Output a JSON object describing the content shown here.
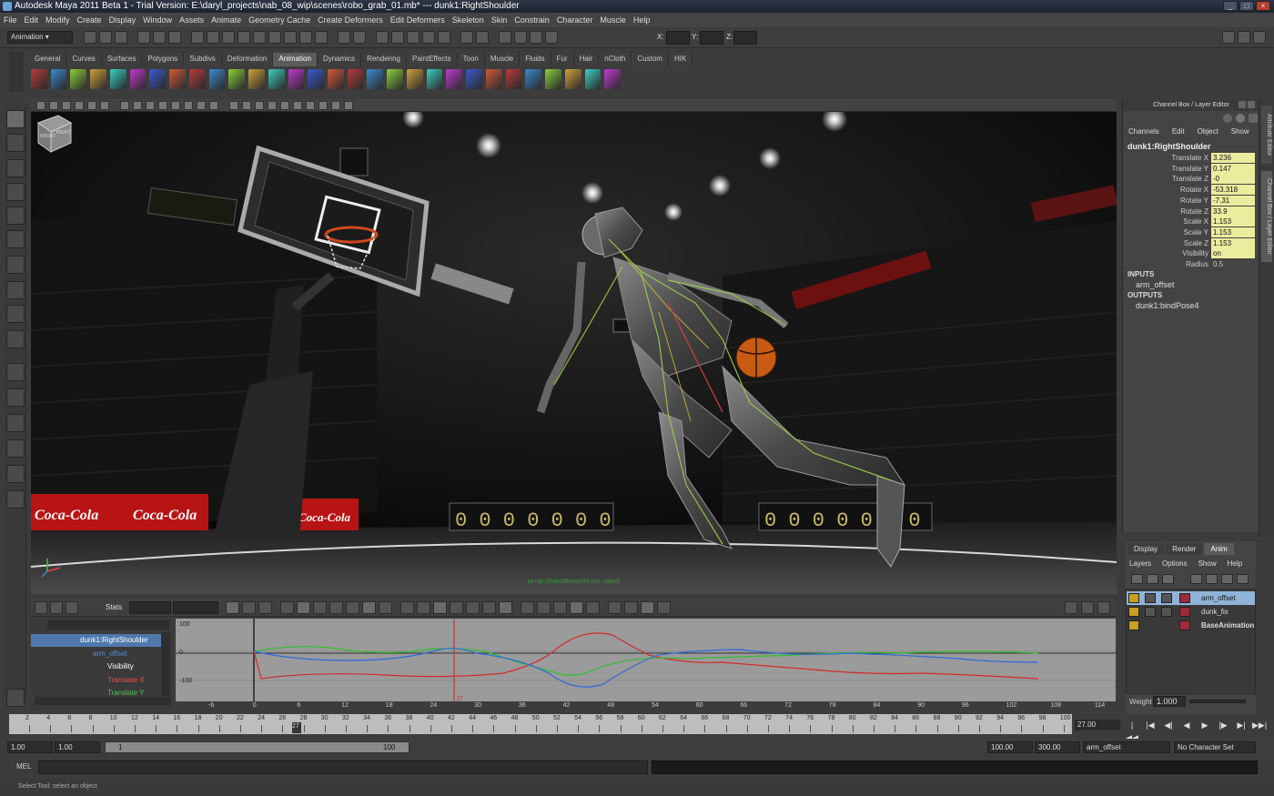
{
  "window": {
    "title": "Autodesk Maya 2011 Beta 1 - Trial Version: E:\\daryl_projects\\nab_08_wip\\scenes\\robo_grab_01.mb*  ---  dunk1:RightShoulder"
  },
  "menubar": [
    "File",
    "Edit",
    "Modify",
    "Create",
    "Display",
    "Window",
    "Assets",
    "Animate",
    "Geometry Cache",
    "Create Deformers",
    "Edit Deformers",
    "Skeleton",
    "Skin",
    "Constrain",
    "Character",
    "Muscle",
    "Help"
  ],
  "statusline": {
    "mode": "Animation",
    "x_label": "X:",
    "y_label": "Y:",
    "z_label": "Z:"
  },
  "shelf": {
    "tabs": [
      "General",
      "Curves",
      "Surfaces",
      "Polygons",
      "Subdivs",
      "Deformation",
      "Animation",
      "Dynamics",
      "Rendering",
      "PaintEffects",
      "Toon",
      "Muscle",
      "Fluids",
      "Fur",
      "Hair",
      "nCloth",
      "Custom",
      "HIK"
    ],
    "active_tab": "Animation"
  },
  "viewport": {
    "scene_caption": "persp (RobotBlueprint.mb: robot)",
    "viewcube_labels": [
      "FRONT",
      "RIGHT"
    ],
    "sign_text": "Coca-Cola"
  },
  "channel_box": {
    "title": "Channel Box / Layer Editor",
    "menu": [
      "Channels",
      "Edit",
      "Object",
      "Show"
    ],
    "node": "dunk1:RightShoulder",
    "attributes": [
      {
        "label": "Translate X",
        "value": "3.236",
        "keyed": true
      },
      {
        "label": "Translate Y",
        "value": "0.147",
        "keyed": true
      },
      {
        "label": "Translate Z",
        "value": "-0",
        "keyed": true
      },
      {
        "label": "Rotate X",
        "value": "-53.318",
        "keyed": true
      },
      {
        "label": "Rotate Y",
        "value": "-7.31",
        "keyed": true
      },
      {
        "label": "Rotate Z",
        "value": "33.9",
        "keyed": true
      },
      {
        "label": "Scale X",
        "value": "1.153",
        "keyed": true
      },
      {
        "label": "Scale Y",
        "value": "1.153",
        "keyed": true
      },
      {
        "label": "Scale Z",
        "value": "1.153",
        "keyed": true
      },
      {
        "label": "Visibility",
        "value": "on",
        "keyed": true
      },
      {
        "label": "Radius",
        "value": "0.5",
        "keyed": false
      }
    ],
    "inputs_label": "INPUTS",
    "inputs": [
      "arm_offset"
    ],
    "outputs_label": "OUTPUTS",
    "outputs": [
      "dunk1:bindPose4"
    ]
  },
  "side_tabs": [
    "Attribute Editor",
    "Channel Box / Layer Editor"
  ],
  "layer_editor": {
    "tabs": [
      "Display",
      "Render",
      "Anim"
    ],
    "active_tab": "Anim",
    "menu": [
      "Layers",
      "Options",
      "Show",
      "Help"
    ],
    "layers": [
      {
        "name": "arm_offset",
        "selected": true
      },
      {
        "name": "dunk_fix",
        "selected": false
      },
      {
        "name": "BaseAnimation",
        "selected": false,
        "bold": true
      }
    ],
    "weight_label": "Weight",
    "weight_value": "1.000"
  },
  "graph_editor": {
    "stats_label": "Stats",
    "outliner": [
      {
        "label": "dunk1:RightShoulder",
        "selected": true,
        "indent": 0,
        "color": "#ffffff"
      },
      {
        "label": "arm_offset",
        "selected": false,
        "indent": 1,
        "color": "#5a8fcf"
      },
      {
        "label": "Visibility",
        "selected": false,
        "indent": 2,
        "color": "#ffffff"
      },
      {
        "label": "Translate X",
        "selected": false,
        "indent": 2,
        "color": "#e05050"
      },
      {
        "label": "Translate Y",
        "selected": false,
        "indent": 2,
        "color": "#4ec04e"
      }
    ],
    "y_labels": [
      "100",
      "0",
      "-100"
    ],
    "x_ticks": [
      "-6",
      "0",
      "6",
      "12",
      "18",
      "24",
      "30",
      "36",
      "42",
      "48",
      "54",
      "60",
      "66",
      "72",
      "78",
      "84",
      "90",
      "96",
      "102",
      "108",
      "114"
    ],
    "current_frame_label": "27",
    "curve_colors": {
      "x": "#d42a2a",
      "y": "#2fbf2f",
      "z": "#2f6bd8"
    }
  },
  "time_slider": {
    "ticks": [
      "2",
      "4",
      "6",
      "8",
      "10",
      "12",
      "14",
      "16",
      "18",
      "20",
      "22",
      "24",
      "26",
      "28",
      "30",
      "32",
      "34",
      "36",
      "38",
      "40",
      "42",
      "44",
      "46",
      "48",
      "50",
      "52",
      "54",
      "56",
      "58",
      "60",
      "62",
      "64",
      "66",
      "68",
      "70",
      "72",
      "74",
      "76",
      "78",
      "80",
      "82",
      "84",
      "86",
      "88",
      "90",
      "92",
      "94",
      "96",
      "98",
      "100"
    ],
    "current": "27",
    "current_field": "27.00"
  },
  "playback_buttons": [
    "|◀◀",
    "|◀",
    "◀|",
    "◀",
    "▶",
    "|▶",
    "▶|",
    "▶▶|"
  ],
  "range_bar": {
    "start": "1.00",
    "start_inner": "1.00",
    "slider_start": "1",
    "slider_end": "100",
    "end_inner": "100.00",
    "end": "300.00",
    "anim_layer": "arm_offset",
    "character_set": "No Character Set"
  },
  "mel": {
    "label": "MEL"
  },
  "help_line": "Select Tool: select an object"
}
